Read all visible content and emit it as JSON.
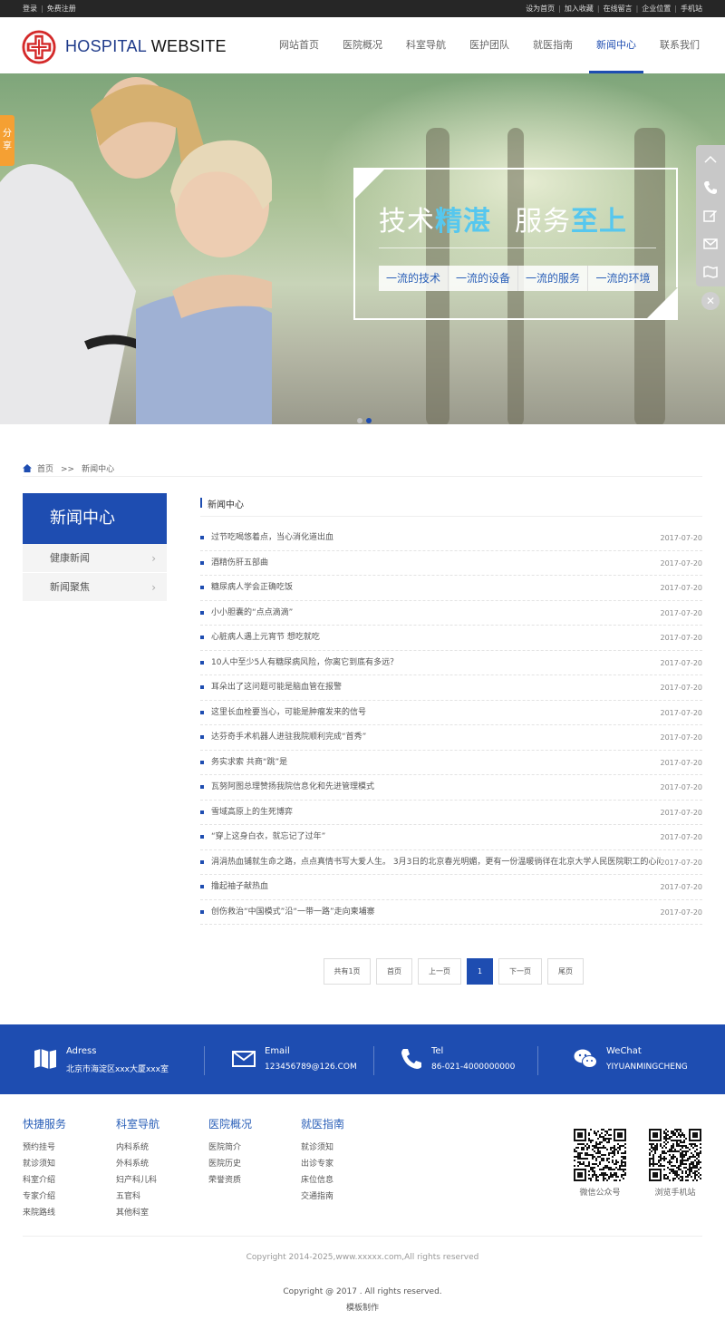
{
  "topbar": {
    "login": "登录",
    "register": "免费注册",
    "links": [
      "设为首页",
      "加入收藏",
      "在线留言",
      "企业位置",
      "手机站"
    ]
  },
  "logo": {
    "part1": "HOSPITAL ",
    "part2": "WEBSITE"
  },
  "nav": [
    {
      "label": "网站首页"
    },
    {
      "label": "医院概况"
    },
    {
      "label": "科室导航"
    },
    {
      "label": "医护团队"
    },
    {
      "label": "就医指南"
    },
    {
      "label": "新闻中心",
      "active": true
    },
    {
      "label": "联系我们"
    }
  ],
  "banner": {
    "slogan_a": "技术",
    "slogan_b": "精湛",
    "slogan_c": "服务",
    "slogan_d": "至上",
    "tags": [
      "一流的技术",
      "一流的设备",
      "一流的服务",
      "一流的环境"
    ]
  },
  "share": "分享",
  "breadcrumb": {
    "home": "首页",
    "sep": ">>",
    "current": "新闻中心"
  },
  "sidebar": {
    "title": "新闻中心",
    "items": [
      "健康新闻",
      "新闻聚焦"
    ]
  },
  "main": {
    "title": "新闻中心",
    "news": [
      {
        "title": "过节吃喝悠着点，当心消化道出血",
        "date": "2017-07-20"
      },
      {
        "title": "酒精伤肝五部曲",
        "date": "2017-07-20"
      },
      {
        "title": "糖尿病人学会正确吃饭",
        "date": "2017-07-20"
      },
      {
        "title": "小小胆囊的“点点滴滴”",
        "date": "2017-07-20"
      },
      {
        "title": "心脏病人遇上元宵节 想吃就吃",
        "date": "2017-07-20"
      },
      {
        "title": "10人中至少5人有糖尿病风险，你离它到底有多远？",
        "date": "2017-07-20"
      },
      {
        "title": "耳朵出了这问题可能是脑血管在报警",
        "date": "2017-07-20"
      },
      {
        "title": "这里长血栓要当心，可能是肿瘤发来的信号",
        "date": "2017-07-20"
      },
      {
        "title": "达芬奇手术机器人进驻我院顺利完成“首秀”",
        "date": "2017-07-20"
      },
      {
        "title": "务实求索 共商“跳”是",
        "date": "2017-07-20"
      },
      {
        "title": "瓦努阿图总理赞扬我院信息化和先进管理模式",
        "date": "2017-07-20"
      },
      {
        "title": "雪域高原上的生死博弈",
        "date": "2017-07-20"
      },
      {
        "title": "“穿上这身白衣，就忘记了过年”",
        "date": "2017-07-20"
      },
      {
        "title": "涓涓热血铺就生命之路，点点真情书写大爱人生。 3月3日的北京春光明媚，更有一份温暖徜徉在北京大学人民医院职工的心间。",
        "date": "2017-07-20"
      },
      {
        "title": "撸起袖子献热血",
        "date": "2017-07-20"
      },
      {
        "title": "创伤救治“中国模式”沿“一带一路”走向柬埔寨",
        "date": "2017-07-20"
      }
    ]
  },
  "pager": {
    "total": "共有1页",
    "first": "首页",
    "prev": "上一页",
    "current": "1",
    "next": "下一页",
    "last": "尾页"
  },
  "contact": [
    {
      "label": "Adress",
      "value": "北京市海淀区xxx大厦xxx室",
      "icon": "map-icon"
    },
    {
      "label": "Email",
      "value": "123456789@126.COM",
      "icon": "mail-icon"
    },
    {
      "label": "Tel",
      "value": "86-021-4000000000",
      "icon": "phone-icon"
    },
    {
      "label": "WeChat",
      "value": "YIYUANMINGCHENG",
      "icon": "wechat-icon"
    }
  ],
  "footer": {
    "cols": [
      {
        "title": "快捷服务",
        "links": [
          "预约挂号",
          "就诊须知",
          "科室介绍",
          "专家介绍",
          "来院路线"
        ]
      },
      {
        "title": "科室导航",
        "links": [
          "内科系统",
          "外科系统",
          "妇产科儿科",
          "五官科",
          "其他科室"
        ]
      },
      {
        "title": "医院概况",
        "links": [
          "医院简介",
          "医院历史",
          "荣誉资质"
        ]
      },
      {
        "title": "就医指南",
        "links": [
          "就诊须知",
          "出诊专家",
          "床位信息",
          "交通指南"
        ]
      }
    ],
    "qr1": "微信公众号",
    "qr2": "浏览手机站",
    "copyright1": "Copyright 2014-2025,www.xxxxx.com,All rights reserved",
    "copyright2": "Copyright @ 2017 . All rights reserved.",
    "copyright3": "模板制作"
  },
  "colors": {
    "primary": "#1e4db1",
    "accent": "#56c7ee",
    "share": "#f5a033"
  }
}
